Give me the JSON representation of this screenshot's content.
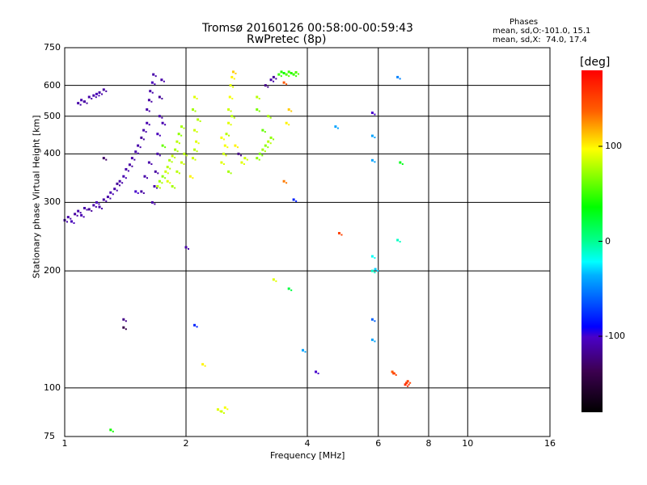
{
  "chart_data": {
    "type": "scatter",
    "title": "Tromsø 20160126 00:58:00-00:59:43",
    "subtitle": "RwPretec (8p)",
    "stats": {
      "heading": "Phases",
      "line_o": "mean, sd,O:-101.0, 15.1",
      "line_x": "mean, sd,X:  74.0, 17.4"
    },
    "xlabel": "Frequency [MHz]",
    "ylabel": "Stationary phase Virtual Height [km]",
    "xscale": "log",
    "yscale": "log",
    "xlim": [
      1,
      16
    ],
    "ylim": [
      75,
      750
    ],
    "xticks": [
      1,
      2,
      4,
      6,
      8,
      10,
      16
    ],
    "yticks": [
      75,
      100,
      200,
      300,
      400,
      500,
      600,
      750
    ],
    "xgrid": [
      2,
      4,
      6,
      8,
      10
    ],
    "ygrid": [
      100,
      200,
      300,
      400,
      500,
      600
    ],
    "colorbar": {
      "label": "[deg]",
      "range": [
        -180,
        180
      ],
      "ticks": [
        100,
        0,
        -100
      ]
    },
    "points": [
      [
        1.0,
        270,
        -110
      ],
      [
        1.02,
        275,
        -110
      ],
      [
        1.04,
        268,
        -105
      ],
      [
        1.06,
        280,
        -112
      ],
      [
        1.08,
        285,
        -110
      ],
      [
        1.1,
        278,
        -108
      ],
      [
        1.12,
        290,
        -110
      ],
      [
        1.15,
        288,
        -115
      ],
      [
        1.18,
        295,
        -110
      ],
      [
        1.2,
        300,
        -105
      ],
      [
        1.22,
        292,
        -110
      ],
      [
        1.25,
        305,
        -112
      ],
      [
        1.28,
        310,
        -110
      ],
      [
        1.3,
        318,
        -108
      ],
      [
        1.33,
        325,
        -110
      ],
      [
        1.35,
        335,
        -115
      ],
      [
        1.37,
        340,
        -110
      ],
      [
        1.4,
        350,
        -108
      ],
      [
        1.42,
        365,
        -110
      ],
      [
        1.45,
        375,
        -112
      ],
      [
        1.47,
        390,
        -110
      ],
      [
        1.5,
        405,
        -108
      ],
      [
        1.52,
        420,
        -110
      ],
      [
        1.55,
        440,
        -115
      ],
      [
        1.57,
        460,
        -110
      ],
      [
        1.6,
        480,
        -108
      ],
      [
        1.6,
        520,
        -110
      ],
      [
        1.62,
        550,
        -112
      ],
      [
        1.63,
        580,
        -110
      ],
      [
        1.65,
        610,
        -105
      ],
      [
        1.66,
        640,
        -110
      ],
      [
        1.65,
        300,
        -110
      ],
      [
        1.67,
        330,
        -108
      ],
      [
        1.68,
        360,
        -112
      ],
      [
        1.7,
        400,
        -110
      ],
      [
        1.7,
        450,
        -105
      ],
      [
        1.72,
        500,
        -110
      ],
      [
        1.72,
        560,
        -115
      ],
      [
        1.74,
        620,
        -110
      ],
      [
        1.75,
        480,
        -108
      ],
      [
        1.62,
        380,
        -110
      ],
      [
        1.58,
        350,
        -110
      ],
      [
        1.55,
        320,
        -112
      ],
      [
        1.08,
        540,
        -110
      ],
      [
        1.1,
        550,
        -108
      ],
      [
        1.12,
        545,
        -112
      ],
      [
        1.15,
        560,
        -110
      ],
      [
        1.18,
        565,
        -110
      ],
      [
        1.2,
        570,
        -105
      ],
      [
        1.22,
        575,
        -110
      ],
      [
        1.25,
        585,
        -112
      ],
      [
        1.7,
        330,
        80
      ],
      [
        1.72,
        340,
        75
      ],
      [
        1.75,
        350,
        70
      ],
      [
        1.78,
        360,
        85
      ],
      [
        1.8,
        370,
        80
      ],
      [
        1.82,
        385,
        78
      ],
      [
        1.85,
        395,
        82
      ],
      [
        1.88,
        410,
        75
      ],
      [
        1.9,
        430,
        80
      ],
      [
        1.92,
        450,
        70
      ],
      [
        1.95,
        380,
        85
      ],
      [
        1.98,
        400,
        80
      ],
      [
        1.75,
        420,
        60
      ],
      [
        1.8,
        340,
        90
      ],
      [
        1.85,
        330,
        75
      ],
      [
        1.9,
        360,
        80
      ],
      [
        1.95,
        470,
        75
      ],
      [
        2.08,
        390,
        85
      ],
      [
        2.1,
        410,
        80
      ],
      [
        2.12,
        430,
        90
      ],
      [
        2.1,
        460,
        85
      ],
      [
        2.14,
        490,
        80
      ],
      [
        2.08,
        520,
        75
      ],
      [
        2.1,
        560,
        90
      ],
      [
        2.05,
        350,
        100
      ],
      [
        2.45,
        380,
        90
      ],
      [
        2.48,
        400,
        85
      ],
      [
        2.5,
        420,
        95
      ],
      [
        2.52,
        450,
        80
      ],
      [
        2.55,
        480,
        90
      ],
      [
        2.55,
        520,
        85
      ],
      [
        2.57,
        560,
        95
      ],
      [
        2.58,
        600,
        90
      ],
      [
        2.6,
        630,
        100
      ],
      [
        2.62,
        650,
        110
      ],
      [
        2.55,
        360,
        75
      ],
      [
        2.45,
        440,
        95
      ],
      [
        2.6,
        500,
        80
      ],
      [
        2.65,
        420,
        100
      ],
      [
        2.7,
        400,
        -120
      ],
      [
        2.75,
        380,
        90
      ],
      [
        2.8,
        390,
        85
      ],
      [
        3.0,
        390,
        70
      ],
      [
        3.05,
        400,
        65
      ],
      [
        3.1,
        410,
        75
      ],
      [
        3.15,
        420,
        70
      ],
      [
        3.2,
        430,
        80
      ],
      [
        3.25,
        440,
        70
      ],
      [
        3.1,
        460,
        60
      ],
      [
        3.2,
        500,
        75
      ],
      [
        3.0,
        520,
        65
      ],
      [
        3.25,
        620,
        -110
      ],
      [
        3.15,
        600,
        -120
      ],
      [
        3.3,
        630,
        -115
      ],
      [
        3.0,
        560,
        80
      ],
      [
        3.4,
        640,
        50
      ],
      [
        3.45,
        650,
        45
      ],
      [
        3.5,
        645,
        40
      ],
      [
        3.55,
        640,
        55
      ],
      [
        3.6,
        650,
        50
      ],
      [
        3.65,
        645,
        45
      ],
      [
        3.7,
        640,
        50
      ],
      [
        3.75,
        648,
        55
      ],
      [
        3.5,
        610,
        140
      ],
      [
        3.55,
        480,
        100
      ],
      [
        3.6,
        520,
        110
      ],
      [
        2.4,
        88,
        90
      ],
      [
        2.45,
        87,
        85
      ],
      [
        2.5,
        89,
        95
      ],
      [
        6.5,
        110,
        140
      ],
      [
        6.55,
        109,
        150
      ],
      [
        7.0,
        102,
        160
      ],
      [
        7.05,
        103,
        155
      ],
      [
        7.1,
        104,
        150
      ],
      [
        5.8,
        200,
        -10
      ],
      [
        5.8,
        218,
        -20
      ],
      [
        5.9,
        202,
        -30
      ],
      [
        6.7,
        630,
        -50
      ],
      [
        6.7,
        240,
        -10
      ],
      [
        4.2,
        110,
        -100
      ],
      [
        4.7,
        470,
        -40
      ],
      [
        4.8,
        250,
        150
      ],
      [
        2.1,
        145,
        -80
      ],
      [
        1.4,
        150,
        -120
      ],
      [
        1.4,
        143,
        -140
      ],
      [
        1.3,
        78,
        40
      ],
      [
        3.6,
        180,
        20
      ],
      [
        2.2,
        115,
        100
      ],
      [
        5.8,
        150,
        -60
      ],
      [
        5.8,
        133,
        -40
      ],
      [
        5.8,
        385,
        -40
      ],
      [
        5.8,
        445,
        -40
      ],
      [
        5.8,
        510,
        -100
      ],
      [
        3.5,
        340,
        130
      ],
      [
        3.7,
        305,
        -80
      ],
      [
        3.3,
        190,
        90
      ],
      [
        3.9,
        125,
        -40
      ],
      [
        6.8,
        380,
        30
      ],
      [
        1.25,
        390,
        -130
      ],
      [
        1.5,
        320,
        -100
      ],
      [
        2.0,
        230,
        -110
      ]
    ]
  }
}
